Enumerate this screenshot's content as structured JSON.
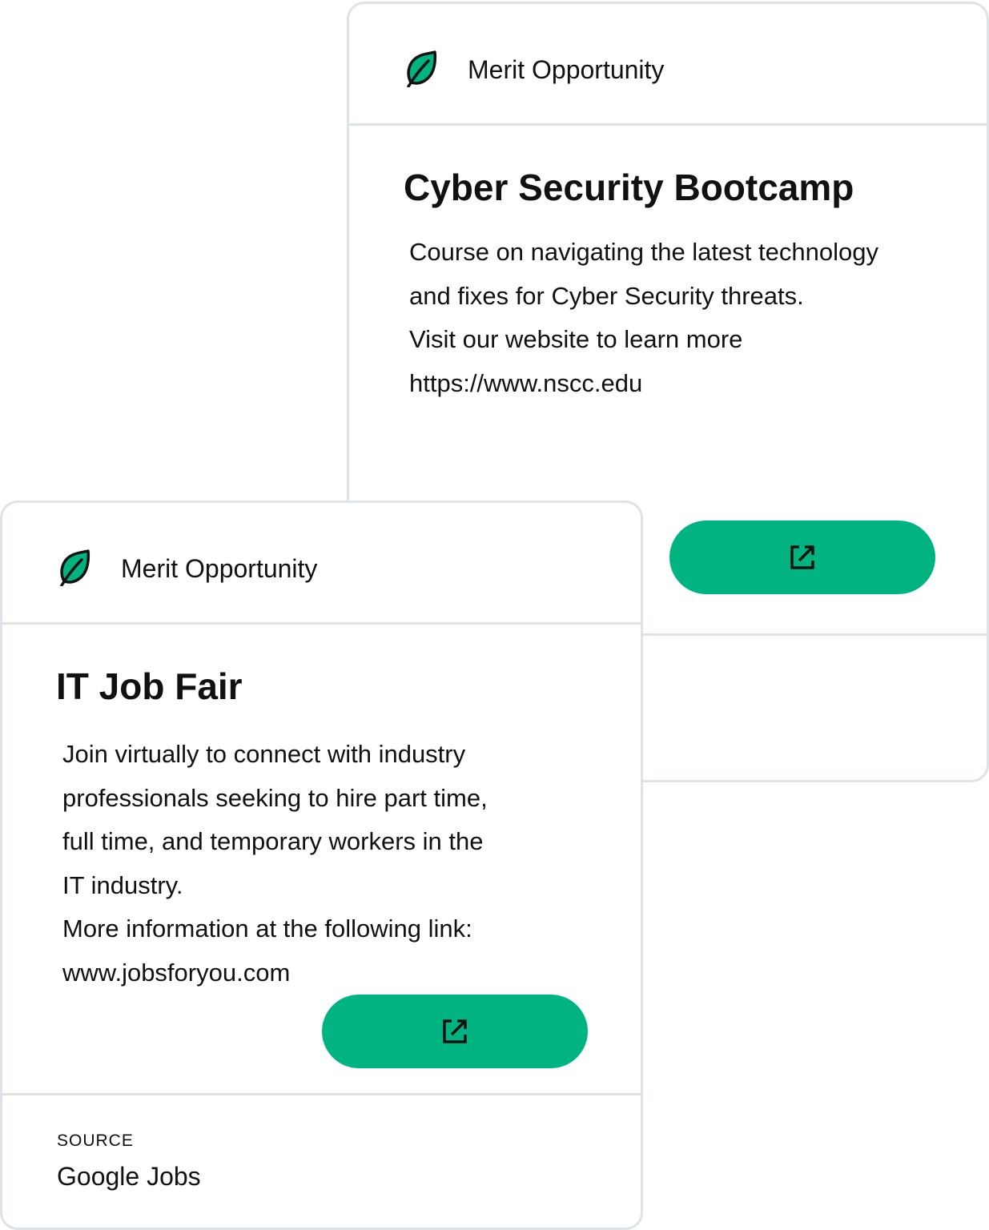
{
  "colors": {
    "accent": "#00b482",
    "border": "#dde3e6",
    "text": "#111111"
  },
  "cards": [
    {
      "header_label": "Merit Opportunity",
      "header_icon": "leaf-icon",
      "title": "Cyber Security Bootcamp",
      "description_lines": [
        "Course on navigating the latest technology",
        "and fixes for Cyber Security threats.",
        "Visit our website to learn more",
        "https://www.nscc.edu"
      ],
      "button_icon": "external-link-icon"
    },
    {
      "header_label": "Merit Opportunity",
      "header_icon": "leaf-icon",
      "title": "IT Job Fair",
      "description_lines": [
        "Join virtually to connect with industry",
        "professionals seeking to hire part time,",
        "full time, and temporary workers in the",
        "IT industry.",
        "More information at the following link:",
        "www.jobsforyou.com"
      ],
      "button_icon": "external-link-icon",
      "source_label": "SOURCE",
      "source_value": "Google Jobs"
    }
  ]
}
